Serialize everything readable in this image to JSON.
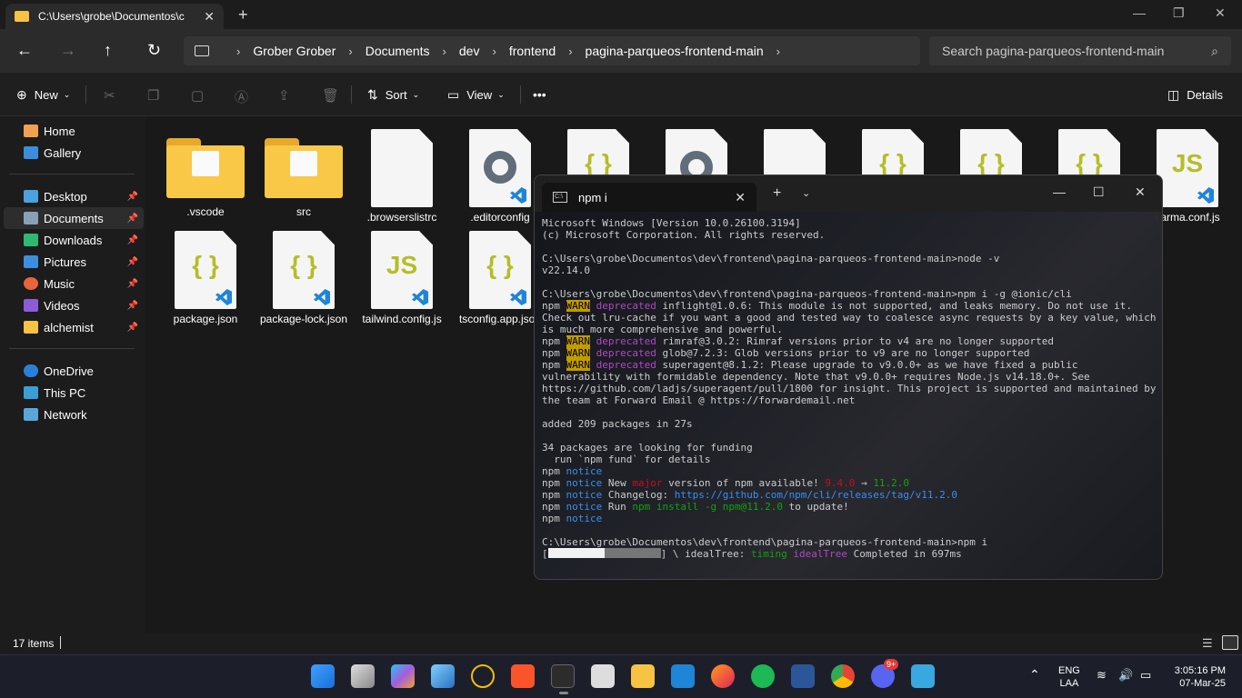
{
  "explorer": {
    "tab_title": "C:\\Users\\grobe\\Documentos\\c",
    "breadcrumb": [
      "Grober Grober",
      "Documents",
      "dev",
      "frontend",
      "pagina-parqueos-frontend-main"
    ],
    "search_placeholder": "Search pagina-parqueos-frontend-main",
    "toolbar": {
      "new": "New",
      "sort": "Sort",
      "view": "View",
      "more": "•••",
      "details": "Details"
    },
    "sidebar": {
      "home": "Home",
      "gallery": "Gallery",
      "desktop": "Desktop",
      "documents": "Documents",
      "downloads": "Downloads",
      "pictures": "Pictures",
      "music": "Music",
      "videos": "Videos",
      "alchemist": "alchemist",
      "onedrive": "OneDrive",
      "thispc": "This PC",
      "network": "Network"
    },
    "files": {
      "f1": ".vscode",
      "f2": "src",
      "f3": ".browserslistrc",
      "f4": ".editorconfig",
      "f12": "karma.conf.js",
      "f13": "package.json",
      "f14": "package-lock.json",
      "f15": "tailwind.config.js",
      "f16": "tsconfig.app.json"
    },
    "status": "17 items"
  },
  "terminal": {
    "tab_title": "npm i",
    "l1": "Microsoft Windows [Version 10.0.26100.3194]",
    "l2": "(c) Microsoft Corporation. All rights reserved.",
    "l3": "C:\\Users\\grobe\\Documentos\\dev\\frontend\\pagina-parqueos-frontend-main>node -v",
    "l4": "v22.14.0",
    "l5": "C:\\Users\\grobe\\Documentos\\dev\\frontend\\pagina-parqueos-frontend-main>npm i -g @ionic/cli",
    "npm": "npm",
    "warn": "WARN",
    "deprecated": "deprecated",
    "w1": " inflight@1.0.6: This module is not supported, and leaks memory. Do not use it. Check out lru-cache if you want a good and tested way to coalesce async requests by a key value, which is much more comprehensive and powerful.",
    "w2": " rimraf@3.0.2: Rimraf versions prior to v4 are no longer supported",
    "w3": " glob@7.2.3: Glob versions prior to v9 are no longer supported",
    "w4": " superagent@8.1.2: Please upgrade to v9.0.0+ as we have fixed a public vulnerability with formidable dependency. Note that v9.0.0+ requires Node.js v14.18.0+. See https://github.com/ladjs/superagent/pull/1800 for insight. This project is supported and maintained by the team at Forward Email @ https://forwardemail.net",
    "added": "added 209 packages in 27s",
    "funding1": "34 packages are looking for funding",
    "funding2": "  run `npm fund` for details",
    "notice": "notice",
    "n1a": " New ",
    "n1b": "major",
    "n1c": " version of npm available! ",
    "n1d": "9.4.0",
    "n1e": " → ",
    "n1f": "11.2.0",
    "n2a": " Changelog: ",
    "n2b": "https://github.com/npm/cli/releases/tag/v11.2.0",
    "n3a": " Run ",
    "n3b": "npm install -g npm@11.2.0",
    "n3c": " to update!",
    "l6": "C:\\Users\\grobe\\Documentos\\dev\\frontend\\pagina-parqueos-frontend-main>npm i",
    "p1": "] \\ idealTree: ",
    "p2": "timing",
    "p3": "idealTree",
    "p4": " Completed in 697ms"
  },
  "taskbar": {
    "lang1": "ENG",
    "lang2": "LAA",
    "time": "3:05:16 PM",
    "date": "07-Mar-25",
    "discord_badge": "9+"
  }
}
